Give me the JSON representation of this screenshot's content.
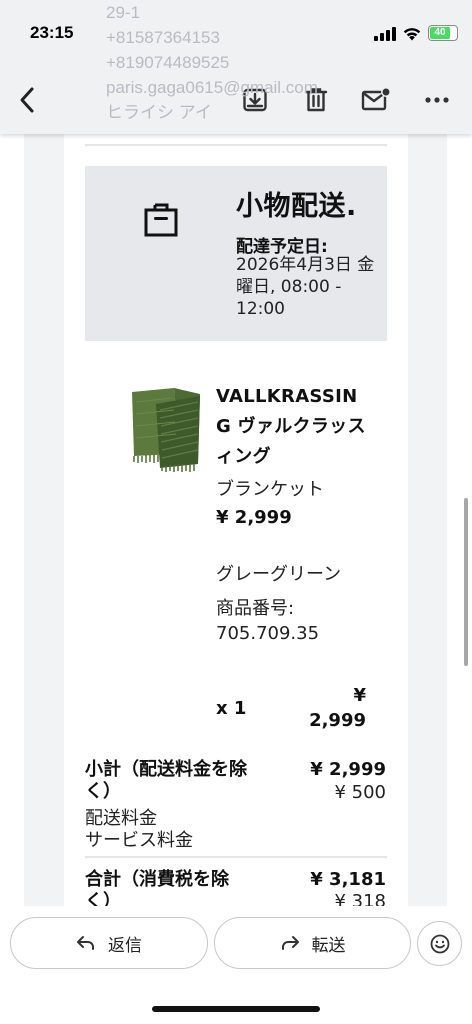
{
  "status_bar": {
    "time": "23:15",
    "battery": "40"
  },
  "header": {
    "back_icon": "chevron-left-icon",
    "archive_icon": "archive-download-icon",
    "delete_icon": "trash-icon",
    "mark_unread_icon": "mail-unread-icon",
    "more_icon": "more-horizontal-icon",
    "scrolled_text": [
      "29-1",
      "+81587364153",
      "+819074489525",
      "paris.gaga0615@gmail.com",
      "ヒライシ アイ"
    ]
  },
  "delivery": {
    "icon": "box-icon",
    "title": "小物配送.",
    "date_label": "配達予定日:",
    "date_value": "2026年4月3日 金曜日, 08:00 - 12:00"
  },
  "product": {
    "name": "VALLKRASSING ヴァルクラッスィング",
    "type": "ブランケット",
    "price": "¥ 2,999",
    "color": "グレーグリーン",
    "number_label": "商品番号:",
    "number": "705.709.35",
    "quantity": "x 1",
    "line_total": "¥ 2,999",
    "image_color": "#5c7a3e"
  },
  "summary": {
    "subtotal_label": "小計（配送料金を除く）",
    "subtotal_value": "¥ 2,999",
    "shipping_label": "配送料金",
    "shipping_value": "¥ 500",
    "service_label": "サービス料金",
    "total_label": "合計（消費税を除く）",
    "total_value": "¥ 3,181",
    "tax_value": "¥ 318"
  },
  "actions": {
    "reply_label": "返信",
    "reply_icon": "reply-arrow-icon",
    "forward_label": "転送",
    "forward_icon": "forward-arrow-icon",
    "emoji_icon": "smiley-icon"
  }
}
